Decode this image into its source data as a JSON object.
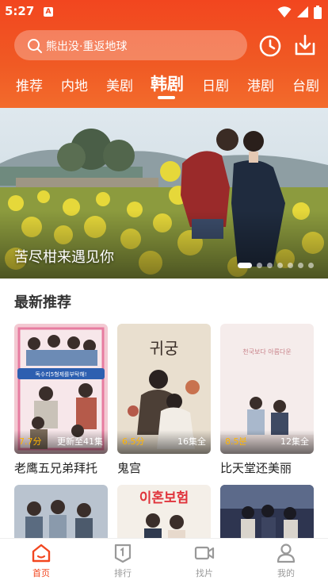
{
  "status_bar": {
    "time": "5:27",
    "app_icon_letter": "A"
  },
  "search": {
    "placeholder": "熊出没·重返地球"
  },
  "tabs": [
    {
      "label": "推荐",
      "active": false
    },
    {
      "label": "内地",
      "active": false
    },
    {
      "label": "美剧",
      "active": false
    },
    {
      "label": "韩剧",
      "active": true
    },
    {
      "label": "日剧",
      "active": false
    },
    {
      "label": "港剧",
      "active": false
    },
    {
      "label": "台剧",
      "active": false
    }
  ],
  "banner": {
    "title": "苦尽柑来遇见你",
    "slide_count": 7,
    "active_slide": 1
  },
  "section": {
    "title": "最新推荐"
  },
  "cards": [
    {
      "title": "老鹰五兄弟拜托",
      "score": "7.7分",
      "episodes": "更新至41集",
      "poster_label": "독수리5형제를부탁해!"
    },
    {
      "title": "鬼宫",
      "score": "6.5分",
      "episodes": "16集全",
      "poster_label": "귀궁"
    },
    {
      "title": "比天堂还美丽",
      "score": "8.5분",
      "episodes": "12集全",
      "poster_label": "천국보다 아름다운"
    }
  ],
  "second_row_posters": [
    {
      "poster_label": ""
    },
    {
      "poster_label": "이혼보험"
    },
    {
      "poster_label": ""
    }
  ],
  "bottom_nav": [
    {
      "label": "首页",
      "icon": "home-icon",
      "active": true
    },
    {
      "label": "排行",
      "icon": "ranking-icon",
      "active": false
    },
    {
      "label": "找片",
      "icon": "video-camera-icon",
      "active": false
    },
    {
      "label": "我的",
      "icon": "user-icon",
      "active": false
    }
  ],
  "colors": {
    "accent": "#f2461f",
    "score": "#ffb400"
  }
}
